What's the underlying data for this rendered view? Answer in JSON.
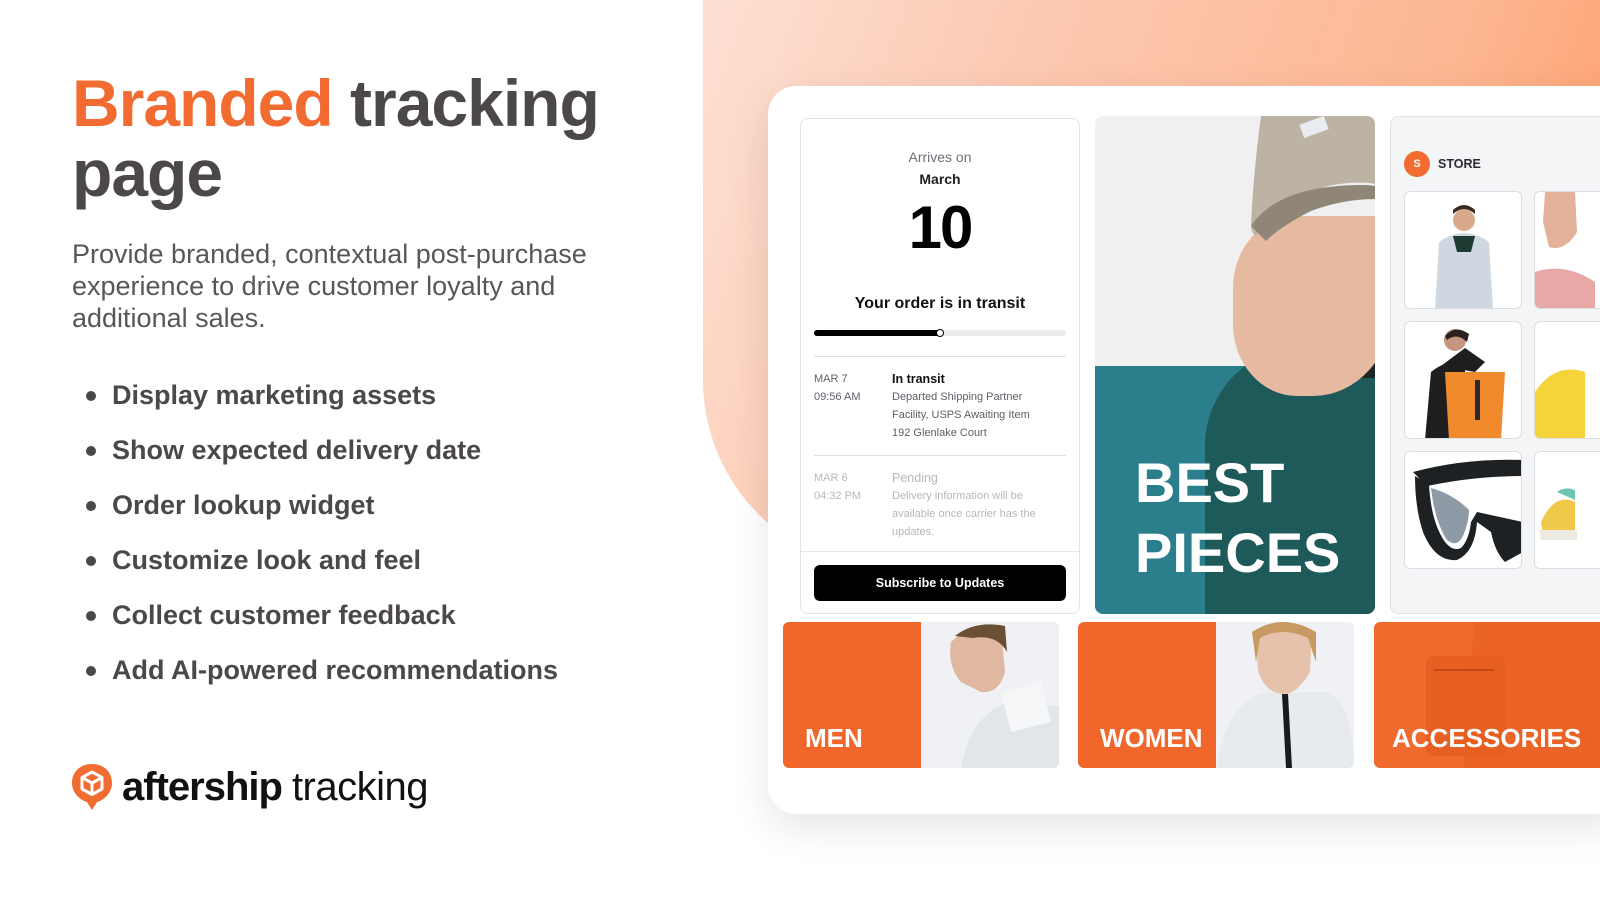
{
  "headline": {
    "accent": "Branded",
    "rest_line1": " tracking",
    "rest_line2": "page"
  },
  "subtitle": "Provide branded, contextual post-purchase experience to drive customer loyalty and additional sales.",
  "features": [
    "Display marketing assets",
    "Show expected delivery date",
    "Order lookup widget",
    "Customize look and feel",
    "Collect customer feedback",
    "Add AI-powered recommendations"
  ],
  "brand": {
    "name": "aftership",
    "product": "tracking",
    "logo_icon": "package-pin-icon"
  },
  "colors": {
    "accent": "#f26b30",
    "heading": "#4b474a",
    "teal": "#2b7e8c",
    "black": "#000000"
  },
  "tracking": {
    "arrives_label": "Arrives on",
    "month": "March",
    "day": "10",
    "status": "Your order is in transit",
    "progress_percent": 50,
    "events": [
      {
        "date": "MAR 7",
        "time": "09:56 AM",
        "title": "In transit",
        "detail_line1": "Departed Shipping Partner",
        "detail_line2": "Facility, USPS Awaiting Item",
        "detail_line3": "192 Glenlake Court"
      },
      {
        "date": "MAR 6",
        "time": "04:32 PM",
        "title": "Pending",
        "detail_line1": "Delivery information will be",
        "detail_line2": "available once carrier has the",
        "detail_line3": "updates."
      }
    ],
    "subscribe_label": "Subscribe to Updates"
  },
  "banner": {
    "line1": "BEST",
    "line2": "PIECES"
  },
  "store": {
    "avatar_letter": "S",
    "name": "STORE",
    "products": [
      "grey-rain-jacket",
      "pink-jacket",
      "orange-backpack",
      "yellow-raincoat",
      "black-sunglasses",
      "sneakers"
    ]
  },
  "categories": [
    {
      "label": "MEN"
    },
    {
      "label": "WOMEN"
    },
    {
      "label": "ACCESSORIES"
    }
  ]
}
